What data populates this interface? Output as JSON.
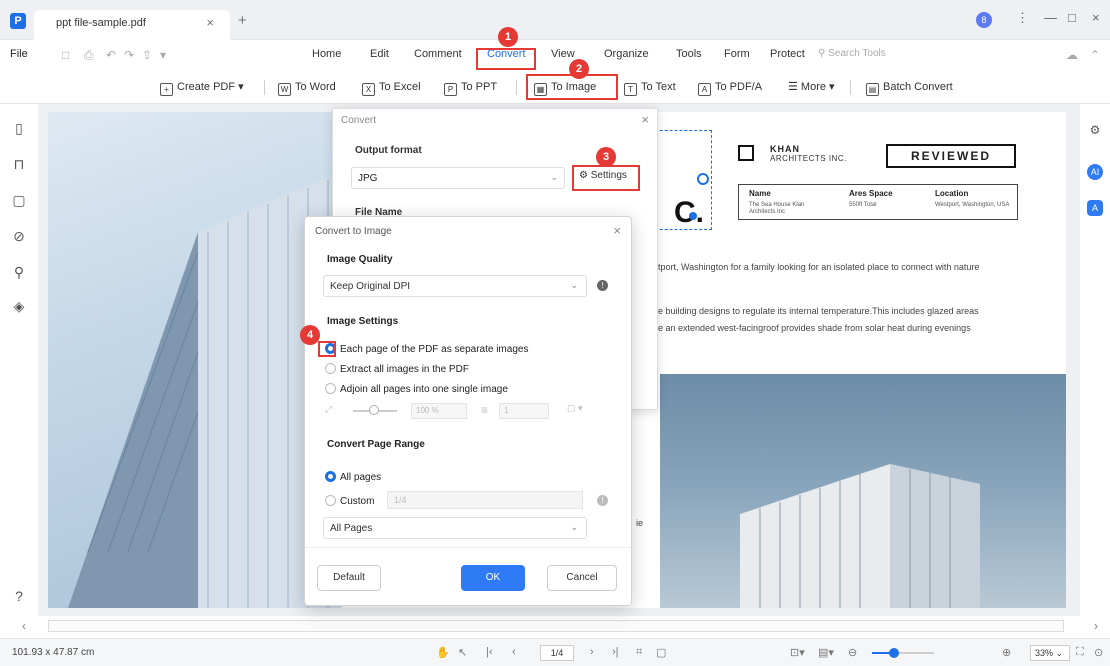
{
  "window": {
    "tab_title": "ppt file-sample.pdf",
    "tab_close": "×",
    "tab_new": "+",
    "avatar_letter": "8",
    "more": "⋮",
    "minimize": "—",
    "maximize": "□",
    "close": "×"
  },
  "menu": {
    "file": "File",
    "items": [
      "Home",
      "Edit",
      "Comment",
      "Convert",
      "View",
      "Organize",
      "Tools",
      "Form",
      "Protect"
    ],
    "active": "Convert",
    "search_placeholder": "Search Tools"
  },
  "toolbar": {
    "create_pdf": "Create PDF",
    "to_word": "To Word",
    "to_excel": "To Excel",
    "to_ppt": "To PPT",
    "to_image": "To Image",
    "to_text": "To Text",
    "to_pdfa": "To PDF/A",
    "more": "More",
    "batch_convert": "Batch Convert"
  },
  "steps": [
    "1",
    "2",
    "3",
    "4"
  ],
  "document": {
    "company_name": "KHAN",
    "company_sub": "ARCHITECTS INC.",
    "stamp": "REVIEWED",
    "big_letter": "C.",
    "table": [
      {
        "header": "Name",
        "value": "The Sea House Klan Architects Inc"
      },
      {
        "header": "Ares Space",
        "value": "550ft Total"
      },
      {
        "header": "Location",
        "value": "Westport, Washington, USA"
      }
    ],
    "line1": "tport, Washington for a family looking for an isolated place to connect with nature",
    "line2": "e building designs to regulate its internal temperature.This includes glazed areas",
    "line3": "e an extended west-facingroof provides shade from solar heat during evenings",
    "fragment": "ie"
  },
  "convert_dialog": {
    "title": "Convert",
    "close": "×",
    "output_format_label": "Output format",
    "output_format_value": "JPG",
    "settings_label": "Settings",
    "file_name_label": "File Name"
  },
  "image_dialog": {
    "title": "Convert to Image",
    "close": "×",
    "quality_label": "Image Quality",
    "quality_value": "Keep Original DPI",
    "settings_label": "Image Settings",
    "options": [
      "Each page of the PDF as separate images",
      "Extract all images in the PDF",
      "Adjoin all pages into one single image"
    ],
    "selected_option": 0,
    "zoom_value": "100 %",
    "spacing_value": "1",
    "page_range_label": "Convert Page Range",
    "range_all": "All pages",
    "range_custom": "Custom",
    "custom_placeholder": "1/4",
    "pages_select": "All Pages",
    "btn_default": "Default",
    "btn_ok": "OK",
    "btn_cancel": "Cancel"
  },
  "statusbar": {
    "dimensions": "101.93 x 47.87 cm",
    "page": "1/4",
    "zoom": "33%",
    "zoom_level": 0.35
  },
  "colors": {
    "accent": "#1d6fe8",
    "highlight": "#e53935"
  }
}
